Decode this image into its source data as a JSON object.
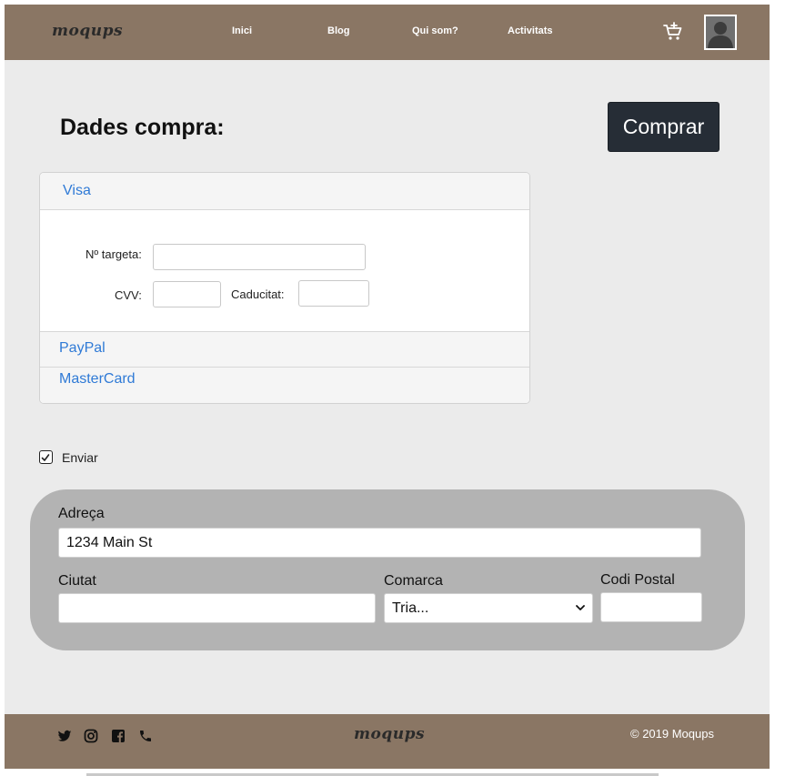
{
  "header": {
    "logo": "moqups",
    "nav": [
      "Inici",
      "Blog",
      "Qui som?",
      "Activitats"
    ]
  },
  "page": {
    "title": "Dades compra:",
    "buy_label": "Comprar"
  },
  "payment": {
    "methods": [
      "Visa",
      "PayPal",
      "MasterCard"
    ],
    "card_number_label": "Nº targeta:",
    "cvv_label": "CVV:",
    "expiry_label": "Caducitat:",
    "card_number_value": "",
    "cvv_value": "",
    "expiry_value": ""
  },
  "shipping": {
    "checkbox_label": "Enviar",
    "checked": true
  },
  "address": {
    "address_label": "Adreça",
    "address_value": "1234 Main St",
    "city_label": "Ciutat",
    "city_value": "",
    "region_label": "Comarca",
    "region_selected": "Tria...",
    "postal_label": "Codi Postal",
    "postal_value": ""
  },
  "footer": {
    "logo": "moqups",
    "icons": [
      "twitter-icon",
      "instagram-icon",
      "facebook-icon",
      "phone-icon"
    ],
    "copyright": "© 2019  Moqups"
  },
  "colors": {
    "bar": "#8a7664",
    "page_bg": "#ebebeb",
    "button": "#262d36",
    "link": "#2f7ad6",
    "address_panel": "#b3b3b3"
  }
}
